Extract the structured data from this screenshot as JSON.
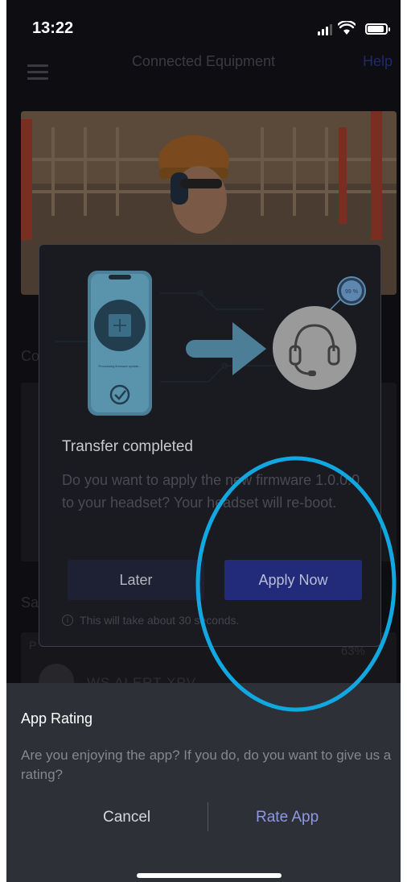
{
  "status_bar": {
    "time": "13:22"
  },
  "nav": {
    "title": "Connected Equipment",
    "help_label": "Help"
  },
  "background": {
    "section1_label": "Co",
    "section2_label": "Sa",
    "card_prefix": "P",
    "battery_text": "63%",
    "device_name": "WS ALERT XPV"
  },
  "dialog": {
    "illustration": {
      "phone_screen_text": "Processing firmware update...",
      "progress_text": "99 %"
    },
    "title": "Transfer completed",
    "body": "Do you want to apply the new firmware 1.0.0.0 to your headset? Your headset will re-boot.",
    "later_label": "Later",
    "apply_label": "Apply Now",
    "note": "This will take about 30 seconds."
  },
  "rating_sheet": {
    "title": "App Rating",
    "body": "Are you enjoying the app? If you do, do you want to give us a rating?",
    "cancel_label": "Cancel",
    "rate_label": "Rate App"
  },
  "colors": {
    "annotation_circle": "#11a8e2",
    "apply_button": "#222b7a",
    "rate_link": "#8e98e6"
  },
  "icons": [
    "menu-icon",
    "signal-icon",
    "wifi-icon",
    "battery-icon",
    "check-icon",
    "arrow-right-icon",
    "headset-icon",
    "info-icon",
    "chip-icon"
  ]
}
